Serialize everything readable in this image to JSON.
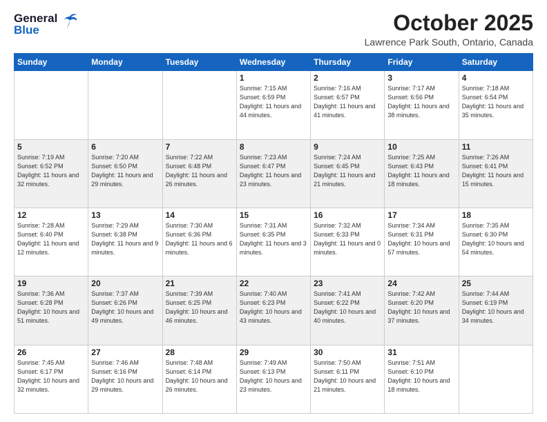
{
  "logo": {
    "line1": "General",
    "line2": "Blue"
  },
  "header": {
    "month": "October 2025",
    "location": "Lawrence Park South, Ontario, Canada"
  },
  "weekdays": [
    "Sunday",
    "Monday",
    "Tuesday",
    "Wednesday",
    "Thursday",
    "Friday",
    "Saturday"
  ],
  "weeks": [
    [
      {
        "day": "",
        "info": ""
      },
      {
        "day": "",
        "info": ""
      },
      {
        "day": "",
        "info": ""
      },
      {
        "day": "1",
        "info": "Sunrise: 7:15 AM\nSunset: 6:59 PM\nDaylight: 11 hours\nand 44 minutes."
      },
      {
        "day": "2",
        "info": "Sunrise: 7:16 AM\nSunset: 6:57 PM\nDaylight: 11 hours\nand 41 minutes."
      },
      {
        "day": "3",
        "info": "Sunrise: 7:17 AM\nSunset: 6:56 PM\nDaylight: 11 hours\nand 38 minutes."
      },
      {
        "day": "4",
        "info": "Sunrise: 7:18 AM\nSunset: 6:54 PM\nDaylight: 11 hours\nand 35 minutes."
      }
    ],
    [
      {
        "day": "5",
        "info": "Sunrise: 7:19 AM\nSunset: 6:52 PM\nDaylight: 11 hours\nand 32 minutes."
      },
      {
        "day": "6",
        "info": "Sunrise: 7:20 AM\nSunset: 6:50 PM\nDaylight: 11 hours\nand 29 minutes."
      },
      {
        "day": "7",
        "info": "Sunrise: 7:22 AM\nSunset: 6:48 PM\nDaylight: 11 hours\nand 26 minutes."
      },
      {
        "day": "8",
        "info": "Sunrise: 7:23 AM\nSunset: 6:47 PM\nDaylight: 11 hours\nand 23 minutes."
      },
      {
        "day": "9",
        "info": "Sunrise: 7:24 AM\nSunset: 6:45 PM\nDaylight: 11 hours\nand 21 minutes."
      },
      {
        "day": "10",
        "info": "Sunrise: 7:25 AM\nSunset: 6:43 PM\nDaylight: 11 hours\nand 18 minutes."
      },
      {
        "day": "11",
        "info": "Sunrise: 7:26 AM\nSunset: 6:41 PM\nDaylight: 11 hours\nand 15 minutes."
      }
    ],
    [
      {
        "day": "12",
        "info": "Sunrise: 7:28 AM\nSunset: 6:40 PM\nDaylight: 11 hours\nand 12 minutes."
      },
      {
        "day": "13",
        "info": "Sunrise: 7:29 AM\nSunset: 6:38 PM\nDaylight: 11 hours\nand 9 minutes."
      },
      {
        "day": "14",
        "info": "Sunrise: 7:30 AM\nSunset: 6:36 PM\nDaylight: 11 hours\nand 6 minutes."
      },
      {
        "day": "15",
        "info": "Sunrise: 7:31 AM\nSunset: 6:35 PM\nDaylight: 11 hours\nand 3 minutes."
      },
      {
        "day": "16",
        "info": "Sunrise: 7:32 AM\nSunset: 6:33 PM\nDaylight: 11 hours\nand 0 minutes."
      },
      {
        "day": "17",
        "info": "Sunrise: 7:34 AM\nSunset: 6:31 PM\nDaylight: 10 hours\nand 57 minutes."
      },
      {
        "day": "18",
        "info": "Sunrise: 7:35 AM\nSunset: 6:30 PM\nDaylight: 10 hours\nand 54 minutes."
      }
    ],
    [
      {
        "day": "19",
        "info": "Sunrise: 7:36 AM\nSunset: 6:28 PM\nDaylight: 10 hours\nand 51 minutes."
      },
      {
        "day": "20",
        "info": "Sunrise: 7:37 AM\nSunset: 6:26 PM\nDaylight: 10 hours\nand 49 minutes."
      },
      {
        "day": "21",
        "info": "Sunrise: 7:39 AM\nSunset: 6:25 PM\nDaylight: 10 hours\nand 46 minutes."
      },
      {
        "day": "22",
        "info": "Sunrise: 7:40 AM\nSunset: 6:23 PM\nDaylight: 10 hours\nand 43 minutes."
      },
      {
        "day": "23",
        "info": "Sunrise: 7:41 AM\nSunset: 6:22 PM\nDaylight: 10 hours\nand 40 minutes."
      },
      {
        "day": "24",
        "info": "Sunrise: 7:42 AM\nSunset: 6:20 PM\nDaylight: 10 hours\nand 37 minutes."
      },
      {
        "day": "25",
        "info": "Sunrise: 7:44 AM\nSunset: 6:19 PM\nDaylight: 10 hours\nand 34 minutes."
      }
    ],
    [
      {
        "day": "26",
        "info": "Sunrise: 7:45 AM\nSunset: 6:17 PM\nDaylight: 10 hours\nand 32 minutes."
      },
      {
        "day": "27",
        "info": "Sunrise: 7:46 AM\nSunset: 6:16 PM\nDaylight: 10 hours\nand 29 minutes."
      },
      {
        "day": "28",
        "info": "Sunrise: 7:48 AM\nSunset: 6:14 PM\nDaylight: 10 hours\nand 26 minutes."
      },
      {
        "day": "29",
        "info": "Sunrise: 7:49 AM\nSunset: 6:13 PM\nDaylight: 10 hours\nand 23 minutes."
      },
      {
        "day": "30",
        "info": "Sunrise: 7:50 AM\nSunset: 6:11 PM\nDaylight: 10 hours\nand 21 minutes."
      },
      {
        "day": "31",
        "info": "Sunrise: 7:51 AM\nSunset: 6:10 PM\nDaylight: 10 hours\nand 18 minutes."
      },
      {
        "day": "",
        "info": ""
      }
    ]
  ]
}
